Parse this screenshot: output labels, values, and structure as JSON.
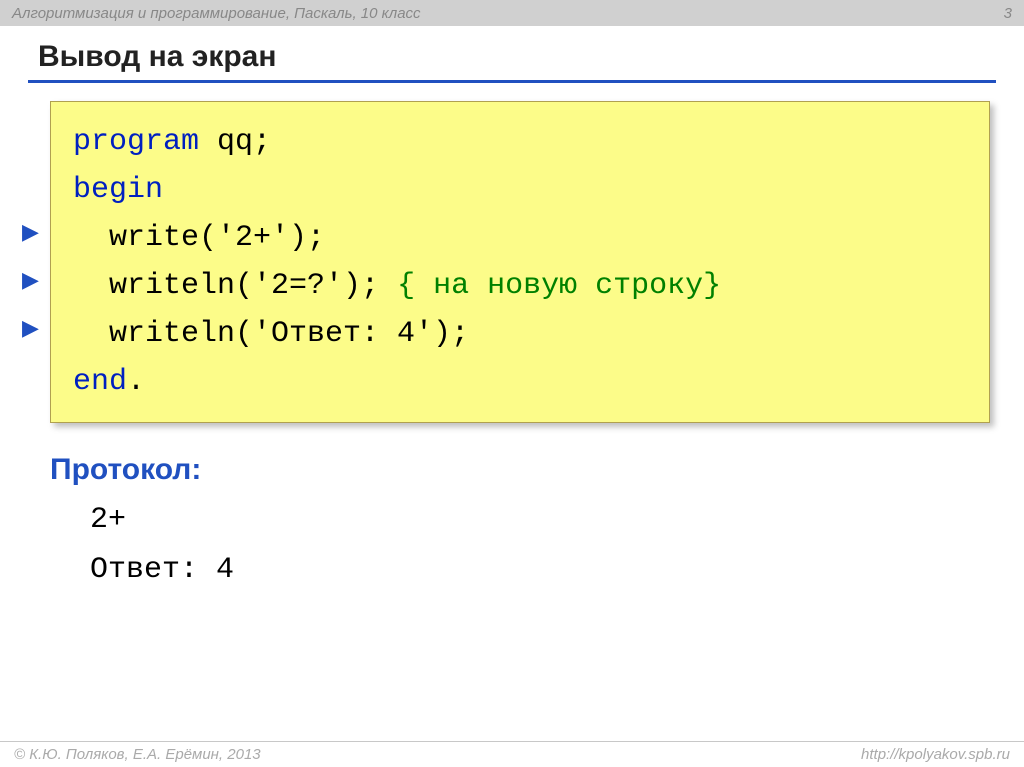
{
  "header": {
    "course": "Алгоритмизация и программирование, Паскаль, 10 класс",
    "page": "3"
  },
  "title": "Вывод на экран",
  "code": {
    "l1": {
      "kw": "program",
      "rest": " qq;"
    },
    "l2": {
      "kw": "begin"
    },
    "l3": {
      "text": "  write('2+');"
    },
    "l4": {
      "text": "  writeln('2=?'); ",
      "cmt": "{ на новую строку}"
    },
    "l5": {
      "text": "  writeln('Ответ: 4');"
    },
    "l6": {
      "kw": "end",
      "rest": "."
    }
  },
  "protocol": {
    "label": "Протокол:",
    "out1": "2+",
    "out2": "Ответ: 4"
  },
  "footer": {
    "left": "© К.Ю. Поляков, Е.А. Ерёмин, 2013",
    "right": "http://kpolyakov.spb.ru"
  }
}
